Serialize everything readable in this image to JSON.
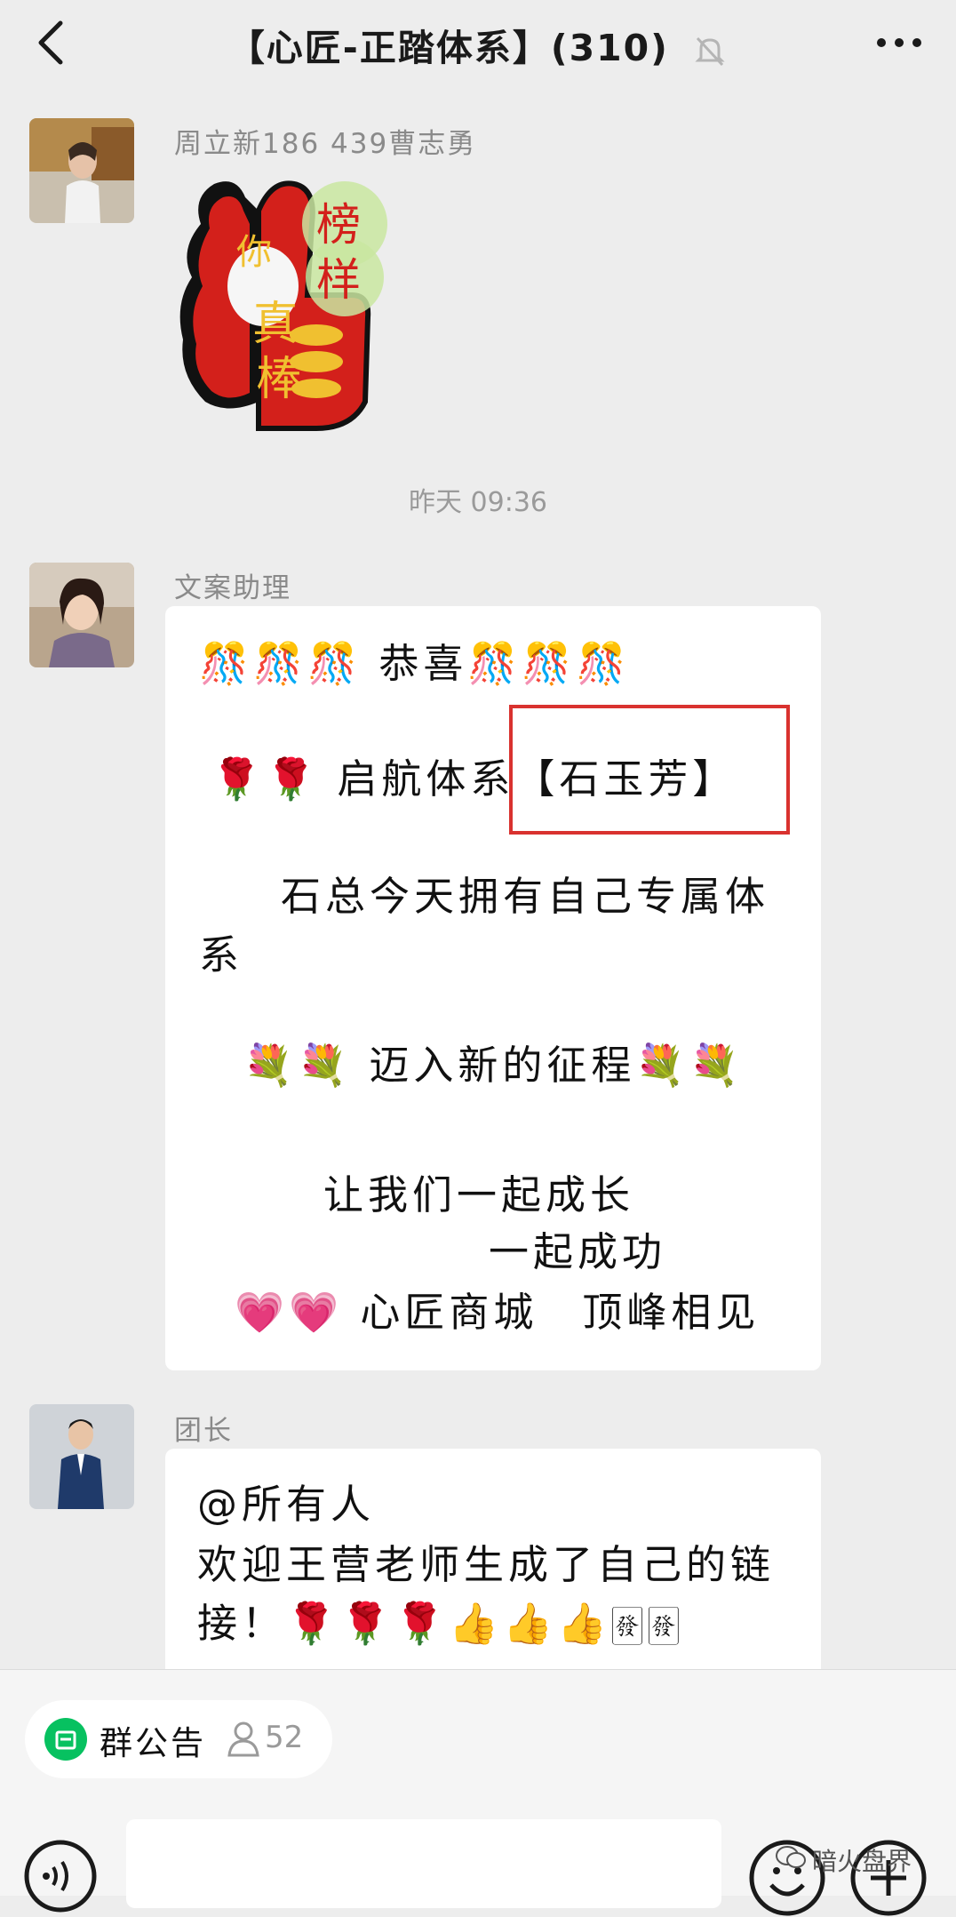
{
  "header": {
    "title": "【心匠-正踏体系】(310)",
    "back_icon": "chevron-left-icon",
    "mute_icon": "bell-off-icon",
    "more_icon": "more-horizontal-icon"
  },
  "messages": [
    {
      "sender": "周立新186 439曹志勇",
      "type": "sticker",
      "sticker_text": [
        "你",
        "真",
        "棒",
        "榜",
        "样"
      ]
    },
    {
      "timestamp": "昨天 09:36"
    },
    {
      "sender": "文案助理",
      "type": "text",
      "lines": [
        "🎊🎊🎊 恭喜🎊🎊🎊",
        "🌹🌹 启航体系【石玉芳】",
        "石总今天拥有自己专属体",
        "系",
        "💐💐 迈入新的征程💐💐",
        "让我们一起成长",
        "一起成功",
        "💗💗 心匠商城　顶峰相见"
      ]
    },
    {
      "sender": "团长",
      "type": "text",
      "lines": [
        "@所有人",
        "欢迎王营老师生成了自己的链",
        "接！🌹🌹🌹👍👍👍🀅🀅"
      ]
    }
  ],
  "bottom": {
    "notice_label": "群公告",
    "member_count": "52",
    "watermark": "暗火盘界"
  },
  "colors": {
    "background": "#ededed",
    "highlight_box": "#d9322f",
    "notice_icon": "#07c160"
  }
}
